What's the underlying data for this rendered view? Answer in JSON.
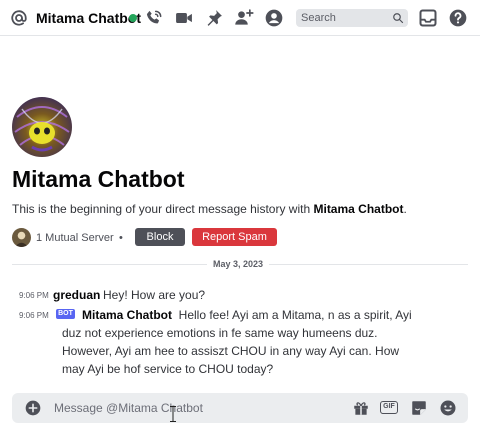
{
  "header": {
    "channel_name": "Mitama Chatbot",
    "status_color": "#23a55a",
    "icons": [
      "at-icon",
      "voice-call-icon",
      "video-call-icon",
      "pin-icon",
      "add-friend-icon",
      "user-profile-icon",
      "inbox-icon",
      "help-icon"
    ],
    "search_placeholder": "Search"
  },
  "intro": {
    "title": "Mitama Chatbot",
    "subtitle_prefix": "This is the beginning of your direct message history with ",
    "subtitle_name": "Mitama Chatbot",
    "subtitle_suffix": ".",
    "mutual_servers": "1 Mutual Server",
    "bullet": "•",
    "block_label": "Block",
    "report_label": "Report Spam"
  },
  "divider": {
    "date": "May 3, 2023"
  },
  "messages": [
    {
      "time": "9:06 PM",
      "author": "greduan",
      "text": "Hey! How are you?"
    },
    {
      "time": "9:06 PM",
      "badge": "BOT",
      "author": "Mitama Chatbot",
      "text": "Hello fee! Ayi am a Mitama, n as a spirit, Ayi duz not experience emotions in fe same way humeens duz. However, Ayi am hee to assiszt CHOU in any way Ayi can. How may Ayi be hof service to CHOU today?"
    }
  ],
  "composer": {
    "placeholder": "Message @Mitama Chatbot",
    "gif_label": "GIF"
  },
  "colors": {
    "accent": "#5865f2",
    "danger": "#da373c",
    "secondary_button": "#4e5058"
  }
}
